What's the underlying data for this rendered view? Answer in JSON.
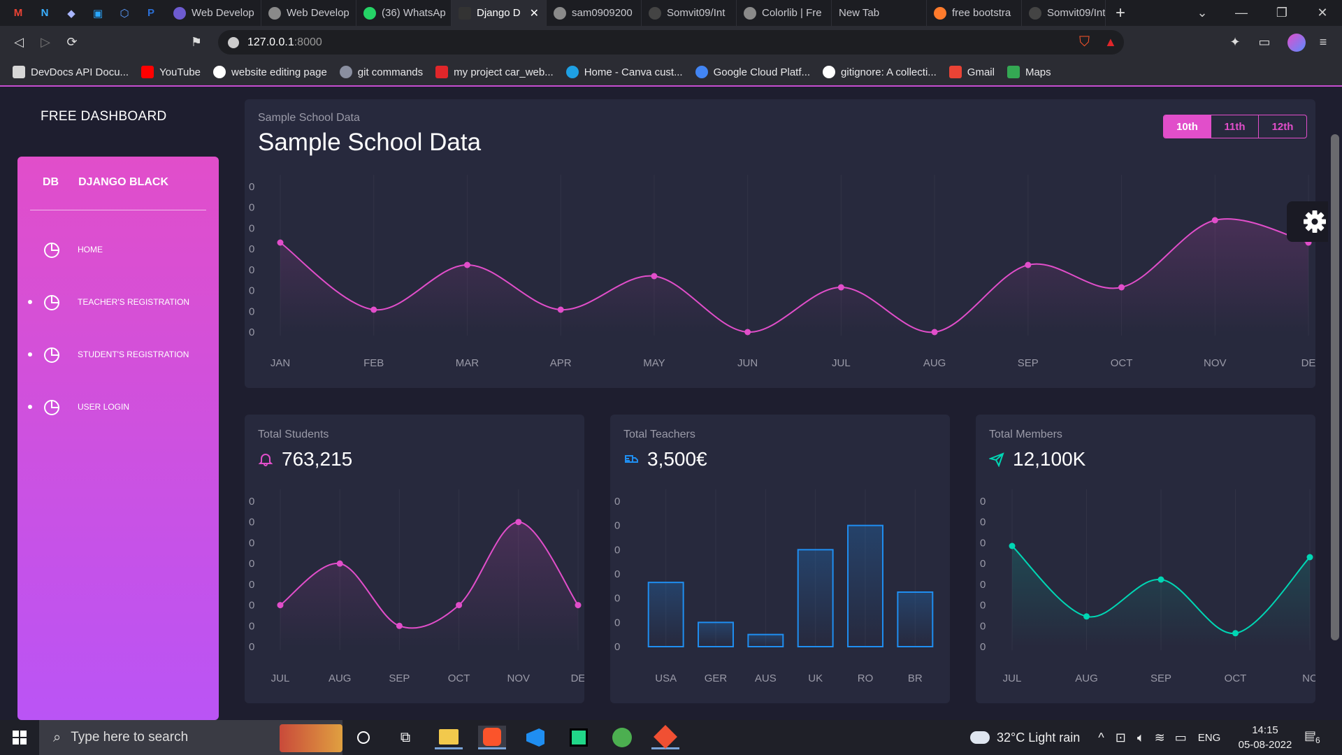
{
  "browser": {
    "tabs": [
      {
        "label": "Web Develop"
      },
      {
        "label": "Web Develop"
      },
      {
        "label": "(36) WhatsAp"
      },
      {
        "label": "Django D",
        "active": true
      },
      {
        "label": "sam0909200"
      },
      {
        "label": "Somvit09/Int"
      },
      {
        "label": "Colorlib | Fre"
      },
      {
        "label": "New Tab"
      },
      {
        "label": "free bootstra"
      },
      {
        "label": "Somvit09/Int"
      }
    ],
    "url_host": "127.0.0.1",
    "url_port": ":8000",
    "bookmarks": [
      {
        "label": "DevDocs API Docu...",
        "color": "#d7d7d7"
      },
      {
        "label": "YouTube",
        "color": "#ff0000"
      },
      {
        "label": "website editing page",
        "color": "#ffffff"
      },
      {
        "label": "git commands",
        "color": "#8a8fa0"
      },
      {
        "label": "my project car_web...",
        "color": "#e0262a"
      },
      {
        "label": "Home - Canva cust...",
        "color": "#1ea0e3"
      },
      {
        "label": "Google Cloud Platf...",
        "color": "#4285f4"
      },
      {
        "label": "gitignore: A collecti...",
        "color": "#ffffff"
      },
      {
        "label": "Gmail",
        "color": "#ea4335"
      },
      {
        "label": "Maps",
        "color": "#34a853"
      }
    ]
  },
  "sidebar": {
    "app_title": "FREE DASHBOARD",
    "brand_short": "DB",
    "brand_name": "DJANGO BLACK",
    "items": [
      {
        "label": "HOME",
        "dot": false
      },
      {
        "label": "TEACHER'S REGISTRATION",
        "dot": true
      },
      {
        "label": "STUDENT'S REGISTRATION",
        "dot": true
      },
      {
        "label": "USER LOGIN",
        "dot": true
      }
    ]
  },
  "main_card": {
    "subtitle": "Sample School Data",
    "title": "Sample School Data",
    "toggle": [
      "10th",
      "11th",
      "12th"
    ],
    "toggle_active": "10th"
  },
  "stats": [
    {
      "subtitle": "Total Students",
      "value": "763,215",
      "icon": "bell-icon"
    },
    {
      "subtitle": "Total Teachers",
      "value": "3,500€",
      "icon": "delivery-icon"
    },
    {
      "subtitle": "Total Members",
      "value": "12,100K",
      "icon": "send-icon"
    }
  ],
  "colors": {
    "pink": "#e14eca",
    "blue": "#1f8ef1",
    "teal": "#00d6b4",
    "card": "#27293d",
    "bg": "#1e1e2f"
  },
  "chart_data": [
    {
      "type": "line",
      "categories": [
        "JAN",
        "FEB",
        "MAR",
        "APR",
        "MAY",
        "JUN",
        "JUL",
        "AUG",
        "SEP",
        "OCT",
        "NOV",
        "DE"
      ],
      "values": [
        100,
        70,
        90,
        70,
        85,
        60,
        80,
        60,
        90,
        80,
        110,
        100
      ],
      "y_tick_labels": [
        "0",
        "0",
        "0",
        "0",
        "0",
        "0",
        "0",
        "0"
      ],
      "ylim": [
        60,
        125
      ],
      "color": "#e14eca"
    },
    {
      "type": "line",
      "categories": [
        "JUL",
        "AUG",
        "SEP",
        "OCT",
        "NOV",
        "DE"
      ],
      "values": [
        80,
        100,
        70,
        80,
        120,
        80
      ],
      "y_tick_labels": [
        "0",
        "0",
        "0",
        "0",
        "0",
        "0",
        "0",
        "0"
      ],
      "ylim": [
        60,
        130
      ],
      "color": "#e14eca"
    },
    {
      "type": "bar",
      "categories": [
        "USA",
        "GER",
        "AUS",
        "UK",
        "RO",
        "BR"
      ],
      "values": [
        53,
        20,
        10,
        80,
        100,
        45
      ],
      "y_tick_labels": [
        "0",
        "0",
        "0",
        "0",
        "0",
        "0",
        "0"
      ],
      "ylim": [
        0,
        120
      ],
      "color": "#1f8ef1"
    },
    {
      "type": "line",
      "categories": [
        "JUL",
        "AUG",
        "SEP",
        "OCT",
        "NC"
      ],
      "values": [
        90,
        27,
        60,
        12,
        80
      ],
      "y_tick_labels": [
        "0",
        "0",
        "0",
        "0",
        "0",
        "0",
        "0",
        "0"
      ],
      "ylim": [
        0,
        130
      ],
      "color": "#00d6b4"
    }
  ],
  "taskbar": {
    "search_placeholder": "Type here to search",
    "weather": "32°C  Light rain",
    "lang": "ENG",
    "time": "14:15",
    "date": "05-08-2022",
    "notifications": "6"
  }
}
